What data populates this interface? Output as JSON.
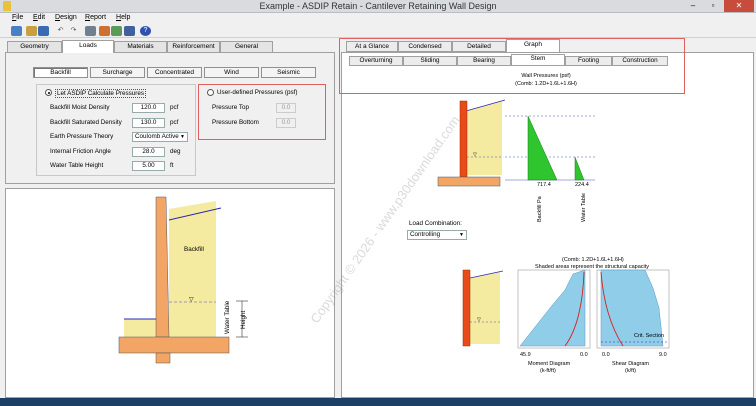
{
  "window": {
    "title": "Example - ASDIP Retain - Cantilever Retaining Wall Design"
  },
  "menu": [
    "File",
    "Edit",
    "Design",
    "Report",
    "Help"
  ],
  "left_tabs": [
    "Geometry",
    "Loads",
    "Materials",
    "Reinforcement",
    "General"
  ],
  "load_tabs": [
    "Backfill",
    "Surcharge",
    "Concentrated",
    "Wind",
    "Seismic"
  ],
  "backfill": {
    "calc_option": "Let ASDIP Calculate Pressures",
    "user_option": "User-defined Pressures (psf)",
    "moist_label": "Backfill Moist Density",
    "moist_value": "120.0",
    "moist_unit": "pcf",
    "sat_label": "Backfill Saturated Density",
    "sat_value": "130.0",
    "sat_unit": "pcf",
    "theory_label": "Earth Pressure Theory",
    "theory_value": "Coulomb Active",
    "friction_label": "Internal Friction Angle",
    "friction_value": "28.0",
    "friction_unit": "deg",
    "water_label": "Water Table Height",
    "water_value": "5.00",
    "water_unit": "ft",
    "ptop_label": "Pressure Top",
    "ptop_value": "0.0",
    "pbot_label": "Pressure Bottom",
    "pbot_value": "0.0"
  },
  "sketch": {
    "backfill_label": "Backfill",
    "water_label": "Water Table",
    "height_label": "Height"
  },
  "right_tabs": [
    "At a Glance",
    "Condensed",
    "Detailed",
    "Graph"
  ],
  "right_subtabs": [
    "Overturning",
    "Sliding",
    "Bearing",
    "Stem",
    "Footing",
    "Construction"
  ],
  "graph": {
    "wp_title": "Wall Pressures (psf)",
    "wp_comb": "(Comb: 1.2D+1.6L+1.6H)",
    "backfill_val": "717.4",
    "backfill_name": "Backfill Pa",
    "water_val": "224.4",
    "water_name": "Water Table",
    "lc_label": "Load Combination:",
    "lc_value": "Controlling",
    "diag_comb": "(Comb: 1.2D+1.6L+1.6H)",
    "diag_note": "Shaded areas represent the structural capacity",
    "moment_left": "45.9",
    "moment_right": "0.0",
    "moment_title": "Moment Diagram",
    "moment_unit": "(k-ft/ft)",
    "shear_left": "0.0",
    "shear_right": "9.0",
    "shear_title": "Shear Diagram",
    "shear_unit": "(k/ft)",
    "crit_label": "Crit. Section"
  },
  "colors": {
    "backfill": "#f5eba0",
    "concrete": "#f2a565",
    "stem": "#e84a1a",
    "pressure": "#2ec52e",
    "capacity": "#8fcde8"
  },
  "watermark": "Copyright © 2026 - www.p30download.com"
}
